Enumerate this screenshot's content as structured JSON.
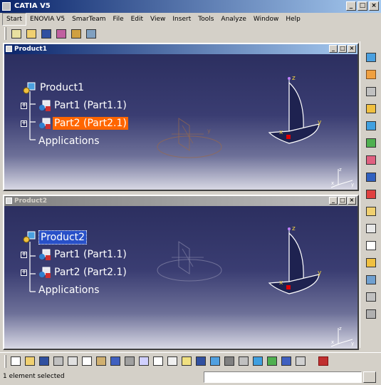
{
  "app": {
    "title": "CATIA V5"
  },
  "window_buttons": [
    "_",
    "□",
    "×"
  ],
  "menu": [
    "Start",
    "ENOVIA V5",
    "SmarTeam",
    "File",
    "Edit",
    "View",
    "Insert",
    "Tools",
    "Analyze",
    "Window",
    "Help"
  ],
  "documents": [
    {
      "title": "Product1",
      "active": true,
      "tree": {
        "root": "Product1",
        "children": [
          "Part1 (Part1.1)",
          "Part2 (Part2.1)"
        ],
        "applications": "Applications",
        "selected": "Part2 (Part2.1)"
      }
    },
    {
      "title": "Product2",
      "active": false,
      "tree": {
        "root": "Product2",
        "children": [
          "Part1 (Part1.1)",
          "Part2 (Part2.1)"
        ],
        "applications": "Applications",
        "selected": "Product2"
      }
    }
  ],
  "axis_labels": {
    "z": "z",
    "y": "y",
    "x": "x"
  },
  "status": {
    "message": "1 element selected",
    "command_value": ""
  },
  "colors": {
    "accent_selected": "#ff6600",
    "selection_blue": "#2850c8",
    "viewport_top": "#2c2f60"
  }
}
